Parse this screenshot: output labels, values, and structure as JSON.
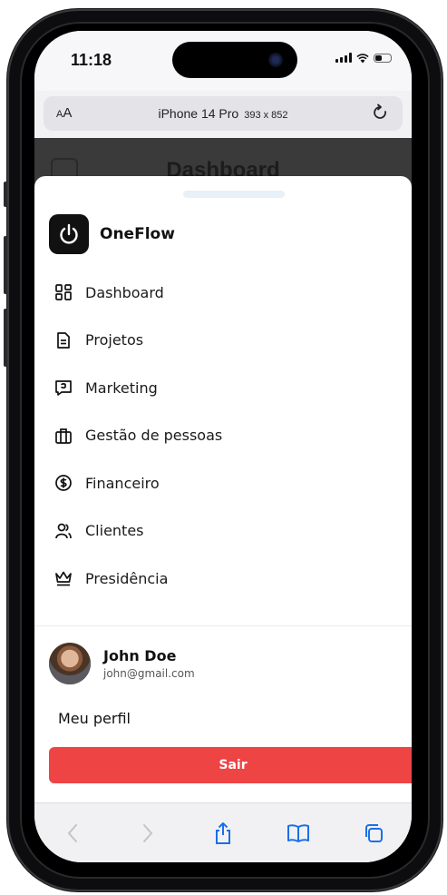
{
  "status_bar": {
    "time": "11:18"
  },
  "browser": {
    "text_size_label_small": "A",
    "text_size_label_large": "A",
    "device_name": "iPhone 14 Pro",
    "device_size": "393 x 852"
  },
  "background_page": {
    "title": "Dashboard"
  },
  "brand": {
    "name": "OneFlow"
  },
  "nav": {
    "items": [
      {
        "label": "Dashboard",
        "icon": "grid-icon"
      },
      {
        "label": "Projetos",
        "icon": "document-icon"
      },
      {
        "label": "Marketing",
        "icon": "chat-icon"
      },
      {
        "label": "Gestão de pessoas",
        "icon": "briefcase-icon"
      },
      {
        "label": "Financeiro",
        "icon": "dollar-circle-icon"
      },
      {
        "label": "Clientes",
        "icon": "users-icon"
      },
      {
        "label": "Presidência",
        "icon": "crown-icon"
      }
    ]
  },
  "user": {
    "name": "John Doe",
    "email": "john@gmail.com"
  },
  "actions": {
    "profile_label": "Meu perfil",
    "logout_label": "Sair"
  },
  "colors": {
    "accent_red": "#ef4444",
    "logo_bg": "#111111"
  }
}
